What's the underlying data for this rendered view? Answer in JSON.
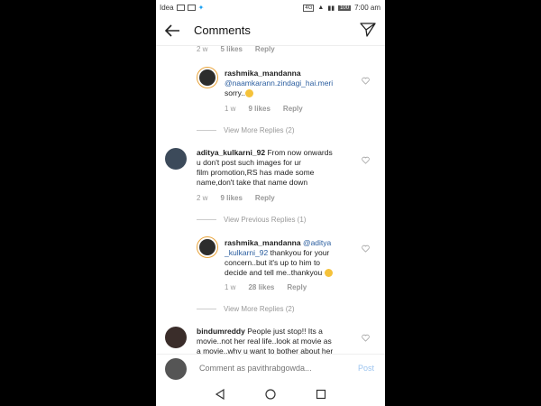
{
  "status_bar": {
    "carrier": "Idea",
    "network": "4G",
    "battery": "100",
    "time": "7:00 am"
  },
  "header": {
    "title": "Comments"
  },
  "comments": [
    {
      "time": "2 w",
      "likes": "5 likes",
      "reply": "Reply"
    },
    {
      "username": "rashmika_mandanna",
      "mention": "@naamkarann.zindagi_hai.meri",
      "text": "sorry..",
      "time": "1 w",
      "likes": "9 likes",
      "reply": "Reply"
    },
    {
      "view_more": "View More Replies (2)"
    },
    {
      "username": "aditya_kulkarni_92",
      "text_line1": "From now onwards",
      "text_line2": "u don't post such images for ur",
      "text_line3": "film promotion,RS has made some",
      "text_line4": "name,don't take that name down",
      "time": "2 w",
      "likes": "9 likes",
      "reply": "Reply"
    },
    {
      "view_previous": "View Previous Replies (1)"
    },
    {
      "username": "rashmika_mandanna",
      "mention_line1": "@aditya",
      "mention_line2": "_kulkarni_92",
      "text_line2": "thankyou for your",
      "text_line3": "concern..but it's up to him to",
      "text_line4": "decide and tell me..thankyou",
      "time": "1 w",
      "likes": "28 likes",
      "reply": "Reply"
    },
    {
      "view_more": "View More Replies (2)"
    },
    {
      "username": "bindumreddy",
      "text_line1": "People just stop!! Its a",
      "text_line2": "movie..not her real life..look at movie as",
      "text_line3": "a movie..why u want to bother about her"
    }
  ],
  "comment_bar": {
    "placeholder": "Comment as pavithrabgowda...",
    "post_label": "Post"
  },
  "colors": {
    "link": "#2a5d9f",
    "post": "#9cc4ef",
    "story_ring": "#e8a33a"
  }
}
